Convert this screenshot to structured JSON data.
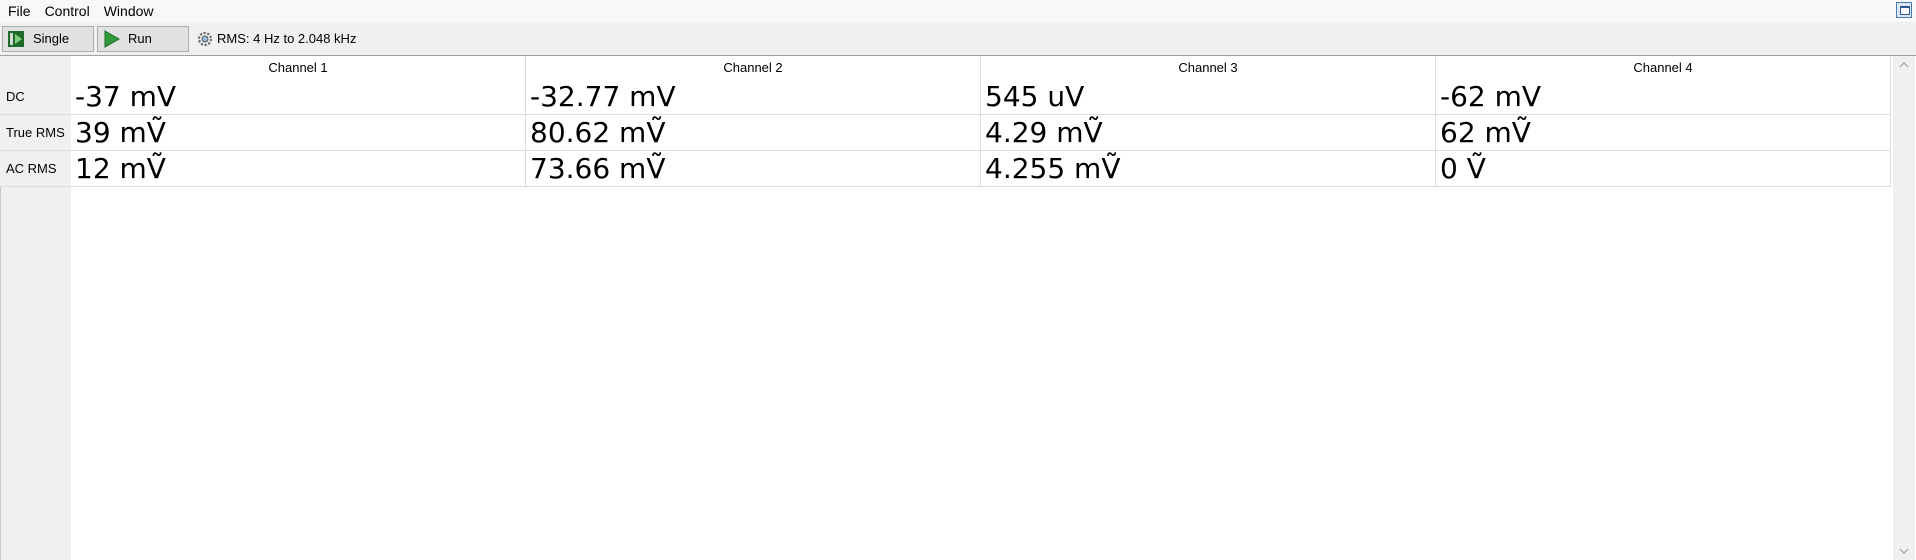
{
  "menu": {
    "items": [
      "File",
      "Control",
      "Window"
    ]
  },
  "toolbar": {
    "single_label": "Single",
    "run_label": "Run",
    "rms_range": "RMS: 4 Hz to 2.048 kHz"
  },
  "table": {
    "columns": [
      "Channel 1",
      "Channel 2",
      "Channel 3",
      "Channel 4"
    ],
    "rows": [
      {
        "label": "DC",
        "values": [
          "-37 mV",
          "-32.77 mV",
          "545 uV",
          "-62 mV"
        ]
      },
      {
        "label": "True RMS",
        "values": [
          "39 mṼ",
          "80.62 mṼ",
          "4.29 mṼ",
          "62 mṼ"
        ]
      },
      {
        "label": "AC RMS",
        "values": [
          "12 mṼ",
          "73.66 mṼ",
          "4.255 mṼ",
          "0 Ṽ"
        ]
      }
    ]
  },
  "colors": {
    "run_green": "#2e9a3a",
    "header_bg": "#f0f0f0"
  },
  "icons": [
    "single-icon",
    "run-icon",
    "gear-icon",
    "restore-icon",
    "scroll-up-icon",
    "scroll-down-icon"
  ]
}
